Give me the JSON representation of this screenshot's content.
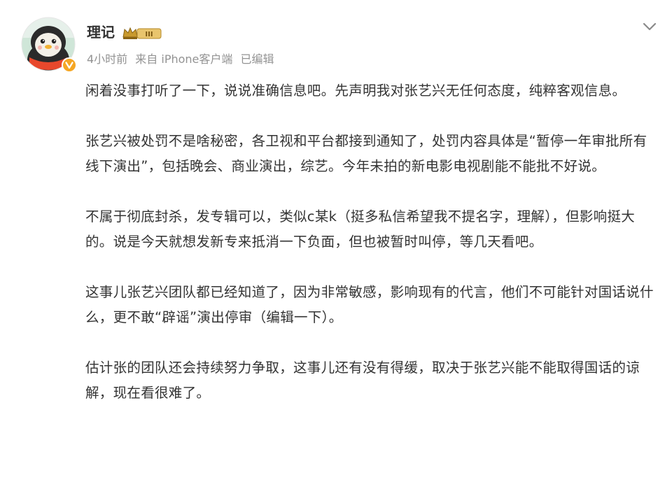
{
  "post": {
    "username": "理记",
    "level_badge": "III",
    "meta": {
      "time": "4小时前",
      "source": "来自 iPhone客户端",
      "edited": "已编辑"
    },
    "paragraphs": [
      "闲着没事打听了一下，说说准确信息吧。先声明我对张艺兴无任何态度，纯粹客观信息。",
      "张艺兴被处罚不是啥秘密，各卫视和平台都接到通知了，处罚内容具体是“暂停一年审批所有线下演出”，包括晚会、商业演出，综艺。今年未拍的新电影电视剧能不能批不好说。",
      "不属于彻底封杀，发专辑可以，类似c某k（挺多私信希望我不提名字，理解），但影响挺大的。说是今天就想发新专来抵消一下负面，但也被暂时叫停，等几天看吧。",
      "这事儿张艺兴团队都已经知道了，因为非常敏感，影响现有的代言，他们不可能针对国话说什么，更不敢“辟谣”演出停审（编辑一下）。",
      "估计张的团队还会持续努力争取，这事儿还有没有得缓，取决于张艺兴能不能取得国话的谅解，现在看很难了。"
    ]
  },
  "colors": {
    "text": "#333333",
    "meta": "#939393",
    "vip_orange": "#f5a623",
    "level_gold": "#c99a2e"
  },
  "icons": {
    "avatar": "penguin-avatar",
    "vip": "vip-v-icon",
    "level": "crown-level-icon",
    "menu": "chevron-down-icon"
  }
}
